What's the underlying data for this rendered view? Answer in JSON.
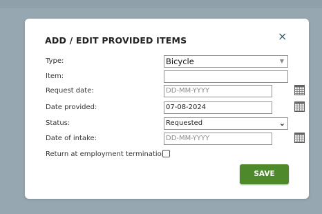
{
  "dialog": {
    "title": "ADD / EDIT PROVIDED ITEMS",
    "close_symbol": "×"
  },
  "form": {
    "type": {
      "label": "Type:",
      "value": "Bicycle"
    },
    "item": {
      "label": "Item:",
      "value": ""
    },
    "request_date": {
      "label": "Request date:",
      "placeholder": "DD-MM-YYYY"
    },
    "date_provided": {
      "label": "Date provided:",
      "value": "07-08-2024"
    },
    "status": {
      "label": "Status:",
      "value": "Requested"
    },
    "date_of_intake": {
      "label": "Date of intake:",
      "placeholder": "DD-MM-YYYY"
    },
    "return_at_termination": {
      "label": "Return at employment termination:",
      "checked": false
    }
  },
  "actions": {
    "save_label": "SAVE"
  },
  "colors": {
    "overlay": "#97a7b1",
    "save_button": "#4e8a2b",
    "close_icon": "#3d5a6e"
  },
  "icons": {
    "calendar": "calendar-icon",
    "close": "close-icon"
  }
}
